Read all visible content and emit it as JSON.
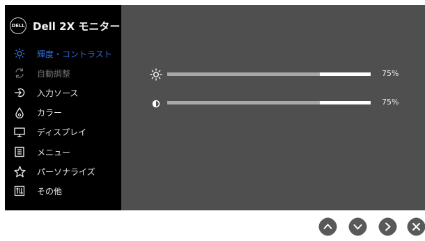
{
  "window": {
    "title": "Dell 2X モニター",
    "logo_text": "DELL"
  },
  "menu": [
    {
      "label": "輝度・コントラスト",
      "icon": "brightness-icon",
      "state": "active"
    },
    {
      "label": "自動調整",
      "icon": "auto-adjust-icon",
      "state": "disabled"
    },
    {
      "label": "入力ソース",
      "icon": "input-source-icon",
      "state": "normal"
    },
    {
      "label": "カラー",
      "icon": "color-icon",
      "state": "normal"
    },
    {
      "label": "ディスプレイ",
      "icon": "display-icon",
      "state": "normal"
    },
    {
      "label": "メニュー",
      "icon": "menu-icon",
      "state": "normal"
    },
    {
      "label": "パーソナライズ",
      "icon": "star-icon",
      "state": "normal"
    },
    {
      "label": "その他",
      "icon": "others-icon",
      "state": "normal"
    }
  ],
  "controls": {
    "brightness": {
      "value_text": "75%",
      "level": 0.75
    },
    "contrast": {
      "value_text": "75%",
      "level": 0.75
    }
  },
  "colors": {
    "active": "#2c6bd8",
    "panel": "#4f4f4f",
    "sidebar": "#000000",
    "nav_button": "#595959"
  },
  "nav_buttons": [
    "up-button",
    "down-button",
    "right-button",
    "close-button"
  ]
}
